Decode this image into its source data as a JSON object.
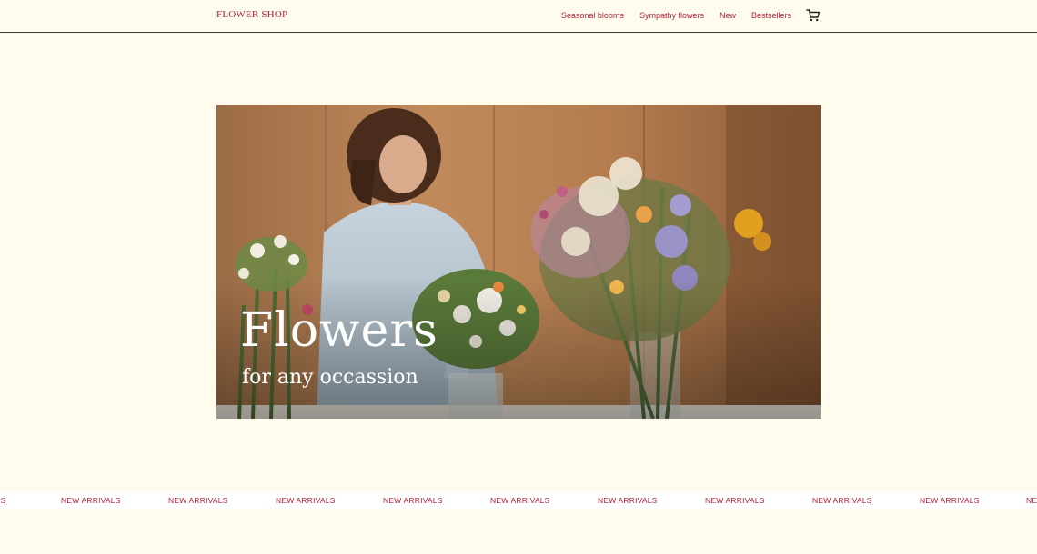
{
  "header": {
    "logo": "FLOWER SHOP",
    "nav": [
      "Seasonal blooms",
      "Sympathy flowers",
      "New",
      "Bestsellers"
    ],
    "cart_icon": "cart-icon"
  },
  "hero": {
    "title": "Flowers",
    "subtitle": "for any occassion",
    "image": "florist-arranging-bouquets-photo"
  },
  "marquee": {
    "text": "NEW ARRIVALS"
  },
  "colors": {
    "background": "#fffcee",
    "accent": "#b02238",
    "header_border": "#3a3a3a"
  }
}
